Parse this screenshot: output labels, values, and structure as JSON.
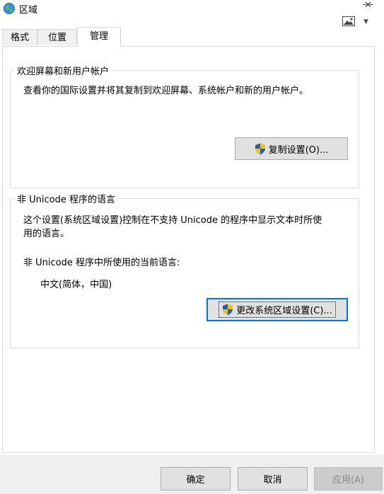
{
  "window": {
    "title": "区域"
  },
  "tabs": [
    {
      "label": "格式"
    },
    {
      "label": "位置"
    },
    {
      "label": "管理"
    }
  ],
  "welcome_group": {
    "title": "欢迎屏幕和新用户帐户",
    "description": "查看你的国际设置并将其复制到欢迎屏幕、系统帐户和新的用户帐户。",
    "copy_button_label": "复制设置(O)..."
  },
  "unicode_group": {
    "title": "非 Unicode 程序的语言",
    "description_line1": "这个设置(系统区域设置)控制在不支持 Unicode 的程序中显示文本时所使",
    "description_line2": "用的语言。",
    "current_label": "非 Unicode 程序中所使用的当前语言:",
    "current_value": "中文(简体，中国)",
    "change_button_label": "更改系统区域设置(C)..."
  },
  "footer": {
    "ok_label": "确定",
    "cancel_label": "取消",
    "apply_label": "应用(A)"
  },
  "colors": {
    "focus_border": "#0078d7",
    "button_bg": "#e1e1e1",
    "window_bg": "#f0f0f0"
  }
}
